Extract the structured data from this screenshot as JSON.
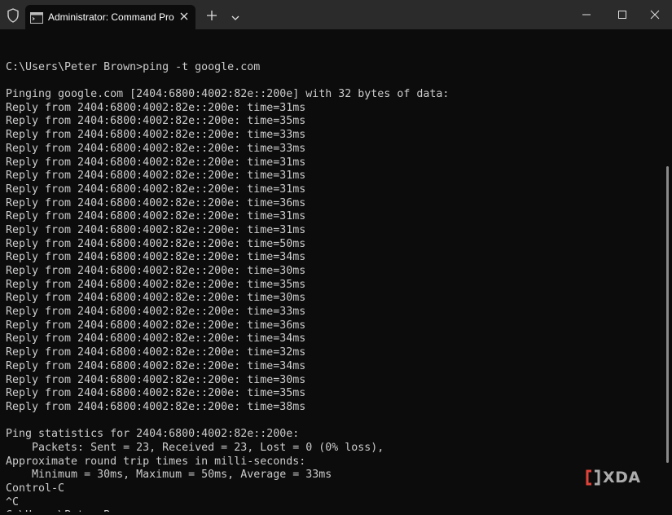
{
  "tab": {
    "title": "Administrator: Command Pro"
  },
  "terminal": {
    "lines": [
      "",
      "C:\\Users\\Peter Brown>ping -t google.com",
      "",
      "Pinging google.com [2404:6800:4002:82e::200e] with 32 bytes of data:",
      "Reply from 2404:6800:4002:82e::200e: time=31ms",
      "Reply from 2404:6800:4002:82e::200e: time=35ms",
      "Reply from 2404:6800:4002:82e::200e: time=33ms",
      "Reply from 2404:6800:4002:82e::200e: time=33ms",
      "Reply from 2404:6800:4002:82e::200e: time=31ms",
      "Reply from 2404:6800:4002:82e::200e: time=31ms",
      "Reply from 2404:6800:4002:82e::200e: time=31ms",
      "Reply from 2404:6800:4002:82e::200e: time=36ms",
      "Reply from 2404:6800:4002:82e::200e: time=31ms",
      "Reply from 2404:6800:4002:82e::200e: time=31ms",
      "Reply from 2404:6800:4002:82e::200e: time=50ms",
      "Reply from 2404:6800:4002:82e::200e: time=34ms",
      "Reply from 2404:6800:4002:82e::200e: time=30ms",
      "Reply from 2404:6800:4002:82e::200e: time=35ms",
      "Reply from 2404:6800:4002:82e::200e: time=30ms",
      "Reply from 2404:6800:4002:82e::200e: time=33ms",
      "Reply from 2404:6800:4002:82e::200e: time=36ms",
      "Reply from 2404:6800:4002:82e::200e: time=34ms",
      "Reply from 2404:6800:4002:82e::200e: time=32ms",
      "Reply from 2404:6800:4002:82e::200e: time=34ms",
      "Reply from 2404:6800:4002:82e::200e: time=30ms",
      "Reply from 2404:6800:4002:82e::200e: time=35ms",
      "Reply from 2404:6800:4002:82e::200e: time=38ms",
      "",
      "Ping statistics for 2404:6800:4002:82e::200e:",
      "    Packets: Sent = 23, Received = 23, Lost = 0 (0% loss),",
      "Approximate round trip times in milli-seconds:",
      "    Minimum = 30ms, Maximum = 50ms, Average = 33ms",
      "Control-C",
      "^C",
      "C:\\Users\\Peter Brown>"
    ]
  },
  "watermark": {
    "text": "XDA"
  },
  "colors": {
    "titlebar_bg": "#2b2b2b",
    "terminal_bg": "#0c0c0c",
    "terminal_fg": "#cccccc",
    "brand_accent": "#e0433a"
  },
  "icons": {
    "admin": "shield-icon",
    "tab": "terminal-icon",
    "tab_close": "close-icon",
    "new_tab": "plus-icon",
    "dropdown": "chevron-down-icon",
    "minimize": "minimize-icon",
    "maximize": "maximize-icon",
    "close": "close-icon"
  }
}
